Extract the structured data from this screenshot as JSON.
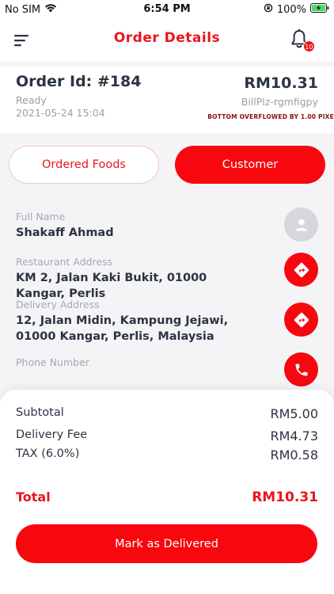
{
  "status_bar": {
    "carrier": "No SIM",
    "time": "6:54 PM",
    "battery": "100%"
  },
  "header": {
    "title": "Order Details",
    "notification_count": "10",
    "icons": [
      "menu-icon",
      "bell-icon"
    ]
  },
  "order": {
    "id_label": "Order Id: #184",
    "status": "Ready",
    "datetime": "2021-05-24 15:04",
    "amount": "RM10.31",
    "bill_ref": "BillPlz-rgmfigpy",
    "overflow_banner": "BOTTOM OVERFLOWED BY 1.00 PIXE"
  },
  "tabs": [
    {
      "label": "Ordered Foods",
      "active": false
    },
    {
      "label": "Customer",
      "active": true
    }
  ],
  "customer": {
    "full_name_label": "Full Name",
    "full_name": "Shakaff Ahmad",
    "restaurant_label": "Restaurant Address",
    "restaurant_address": "KM 2, Jalan Kaki Bukit, 01000 Kangar, Perlis",
    "delivery_label": "Delivery Address",
    "delivery_address": "12, Jalan Midin, Kampung Jejawi, 01000 Kangar, Perlis, Malaysia",
    "phone_label": "Phone Number",
    "phone": ""
  },
  "summary": {
    "subtotal_label": "Subtotal",
    "subtotal": "RM5.00",
    "delivery_fee_label": "Delivery Fee",
    "delivery_fee": "RM4.73",
    "tax_label": "TAX (6.0%)",
    "tax": "RM0.58",
    "total_label": "Total",
    "total": "RM10.31"
  },
  "actions": {
    "mark_delivered": "Mark as Delivered"
  },
  "colors": {
    "accent": "#f7080f",
    "title_red": "#e8161b",
    "text_dark": "#2b3443",
    "text_muted": "#9a9ea6",
    "background": "#f4f4f6"
  }
}
